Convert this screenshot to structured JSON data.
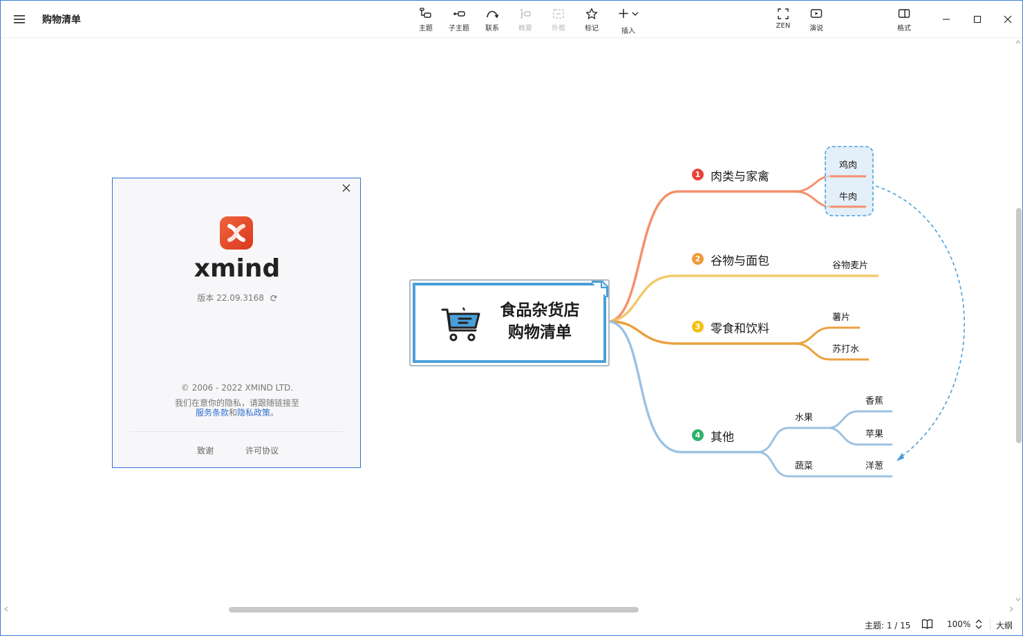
{
  "window": {
    "title": "购物清单"
  },
  "toolbar": {
    "topic": "主题",
    "subtopic": "子主题",
    "relationship": "联系",
    "summary": "概要",
    "boundary": "外框",
    "marker": "标记",
    "insert": "插入",
    "zen": "ZEN",
    "pitch": "演说",
    "format": "格式"
  },
  "mindmap": {
    "central": {
      "line1": "食品杂货店",
      "line2": "购物清单",
      "icon": "shopping-cart-icon"
    },
    "branches": [
      {
        "number": "1",
        "label": "肉类与家禽",
        "color": "#f4906a",
        "badge_color": "#e8443a",
        "children": [
          "鸡肉",
          "牛肉"
        ]
      },
      {
        "number": "2",
        "label": "谷物与面包",
        "color": "#f2c96a",
        "badge_color": "#f09a3c",
        "children": [
          "谷物麦片"
        ]
      },
      {
        "number": "3",
        "label": "零食和饮料",
        "color": "#eba03e",
        "badge_color": "#f2c011",
        "children": [
          "薯片",
          "苏打水"
        ]
      },
      {
        "number": "4",
        "label": "其他",
        "color": "#9cc2e2",
        "badge_color": "#2db36a",
        "children": [
          {
            "label": "水果",
            "children": [
              "香蕉",
              "苹果"
            ]
          },
          {
            "label": "蔬菜",
            "children": [
              "洋葱"
            ]
          }
        ]
      }
    ]
  },
  "about": {
    "wordmark": "xmind",
    "version": "版本 22.09.3168",
    "copyright": "© 2006 - 2022 XMIND LTD.",
    "privacy_text": "我们在意你的隐私，请跟随链接至",
    "terms_link": "服务条款",
    "and": "和",
    "privacy_link": "隐私政策",
    "period": "。",
    "thanks": "致谢",
    "license": "许可协议"
  },
  "status": {
    "topic_count": "主题: 1 / 15",
    "zoom": "100%",
    "outline": "大纲"
  }
}
